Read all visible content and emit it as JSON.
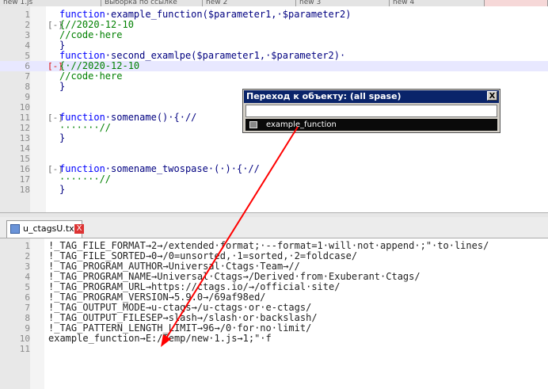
{
  "top_tabs": [
    {
      "label": "new 1.js",
      "active": false
    },
    {
      "label": "Выборка по ссылке",
      "active": false
    },
    {
      "label": "new 2",
      "active": false
    },
    {
      "label": "new 3",
      "active": false
    },
    {
      "label": "new 4",
      "active": true
    }
  ],
  "editor_top": {
    "lines": [
      {
        "n": "1",
        "segs": [
          {
            "t": "function",
            "c": "kw"
          },
          {
            "t": "·example_function($parameter1,·$parameter2)",
            "c": ""
          }
        ]
      },
      {
        "n": "2",
        "segs": [
          {
            "t": "{//2020-12-10",
            "c": "cm"
          }
        ],
        "fold": "[-]"
      },
      {
        "n": "3",
        "segs": [
          {
            "t": "//code·here",
            "c": "cm"
          }
        ]
      },
      {
        "n": "4",
        "segs": [
          {
            "t": "}",
            "c": ""
          }
        ]
      },
      {
        "n": "5",
        "segs": [
          {
            "t": "function",
            "c": "kw"
          },
          {
            "t": "·second_examlpe($parameter1,·$parameter2)·",
            "c": ""
          }
        ]
      },
      {
        "n": "6",
        "segs": [
          {
            "t": "{·//2020-12-10",
            "c": "cm"
          }
        ],
        "fold": "[-]",
        "highlight": true
      },
      {
        "n": "7",
        "segs": [
          {
            "t": "//code·here",
            "c": "cm"
          }
        ]
      },
      {
        "n": "8",
        "segs": [
          {
            "t": "}",
            "c": ""
          }
        ]
      },
      {
        "n": "9",
        "segs": []
      },
      {
        "n": "10",
        "segs": []
      },
      {
        "n": "11",
        "segs": [
          {
            "t": "function",
            "c": "kw"
          },
          {
            "t": "·somename()·{·//",
            "c": ""
          }
        ],
        "fold": "[-]"
      },
      {
        "n": "12",
        "segs": [
          {
            "t": "·······//",
            "c": "cm"
          }
        ]
      },
      {
        "n": "13",
        "segs": [
          {
            "t": "}",
            "c": ""
          }
        ]
      },
      {
        "n": "14",
        "segs": []
      },
      {
        "n": "15",
        "segs": []
      },
      {
        "n": "16",
        "segs": [
          {
            "t": "function",
            "c": "kw"
          },
          {
            "t": "·somename_twospase·(·)·{·//",
            "c": ""
          }
        ],
        "fold": "[-]"
      },
      {
        "n": "17",
        "segs": [
          {
            "t": "·······//",
            "c": "cm"
          }
        ]
      },
      {
        "n": "18",
        "segs": [
          {
            "t": "}",
            "c": ""
          }
        ]
      }
    ]
  },
  "popup": {
    "title": "Переход к объекту: (all spase)",
    "close": "X",
    "input_value": "",
    "items": [
      {
        "label": "example_function",
        "icon": "function-icon"
      }
    ]
  },
  "bottom_tab": {
    "label": "u_ctagsU.txt",
    "close": "X",
    "icon": "file-icon"
  },
  "editor_bottom": {
    "lines": [
      {
        "n": "1",
        "t": "!_TAG_FILE_FORMAT→2→/extended·format;·--format=1·will·not·append·;\"·to·lines/"
      },
      {
        "n": "2",
        "t": "!_TAG_FILE_SORTED→0→/0=unsorted,·1=sorted,·2=foldcase/"
      },
      {
        "n": "3",
        "t": "!_TAG_PROGRAM_AUTHOR→Universal·Ctags·Team→//"
      },
      {
        "n": "4",
        "t": "!_TAG_PROGRAM_NAME→Universal·Ctags→/Derived·from·Exuberant·Ctags/"
      },
      {
        "n": "5",
        "t": "!_TAG_PROGRAM_URL→https://ctags.io/→/official·site/"
      },
      {
        "n": "6",
        "t": "!_TAG_PROGRAM_VERSION→5.9.0→/69af98ed/"
      },
      {
        "n": "7",
        "t": "!_TAG_OUTPUT_MODE→u-ctags→/u-ctags·or·e-ctags/"
      },
      {
        "n": "8",
        "t": "!_TAG_OUTPUT_FILESEP→slash→/slash·or·backslash/"
      },
      {
        "n": "9",
        "t": "!_TAG_PATTERN_LENGTH_LIMIT→96→/0·for·no·limit/"
      },
      {
        "n": "10",
        "t": "example_function→E:/Temp/new·1.js→1;\"·f"
      },
      {
        "n": "11",
        "t": ""
      }
    ]
  },
  "colors": {
    "keyword": "#0000ff",
    "comment": "#008000",
    "arrow": "#ff0000",
    "popup_title_bg": "#0a246a"
  }
}
